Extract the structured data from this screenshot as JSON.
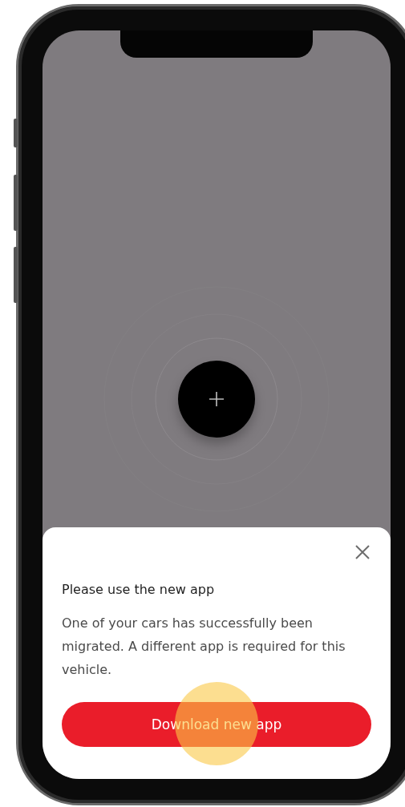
{
  "sheet": {
    "title": "Please use the new app",
    "message": "One of your cars has successfully been migrated. A different app is required for this vehicle.",
    "button": "Download new app"
  }
}
